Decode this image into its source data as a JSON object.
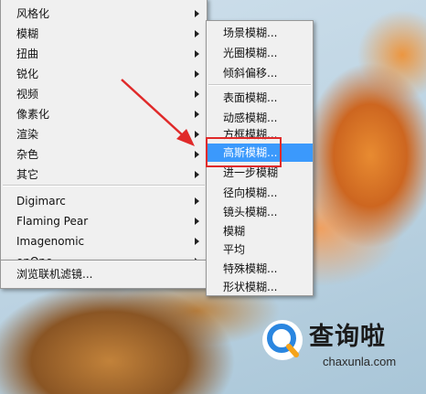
{
  "filter_menu": {
    "items": [
      {
        "label": "风格化"
      },
      {
        "label": "模糊"
      },
      {
        "label": "扭曲"
      },
      {
        "label": "锐化"
      },
      {
        "label": "视频"
      },
      {
        "label": "像素化"
      },
      {
        "label": "渲染"
      },
      {
        "label": "杂色"
      },
      {
        "label": "其它"
      },
      {
        "label": "Digimarc"
      },
      {
        "label": "Flaming Pear"
      },
      {
        "label": "Imagenomic"
      },
      {
        "label": "onOne"
      },
      {
        "label": "浏览联机滤镜..."
      }
    ]
  },
  "blur_submenu": {
    "items": [
      {
        "label": "场景模糊..."
      },
      {
        "label": "光圈模糊..."
      },
      {
        "label": "倾斜偏移..."
      },
      {
        "label": "表面模糊..."
      },
      {
        "label": "动感模糊..."
      },
      {
        "label": "方框模糊..."
      },
      {
        "label": "高斯模糊..."
      },
      {
        "label": "进一步模糊"
      },
      {
        "label": "径向模糊..."
      },
      {
        "label": "镜头模糊..."
      },
      {
        "label": "模糊"
      },
      {
        "label": "平均"
      },
      {
        "label": "特殊模糊..."
      },
      {
        "label": "形状模糊..."
      }
    ]
  },
  "colors": {
    "highlight": "#3b99fc",
    "annotation": "#e02a2a"
  },
  "watermark": {
    "title": "查询啦",
    "url": "chaxunla.com"
  }
}
